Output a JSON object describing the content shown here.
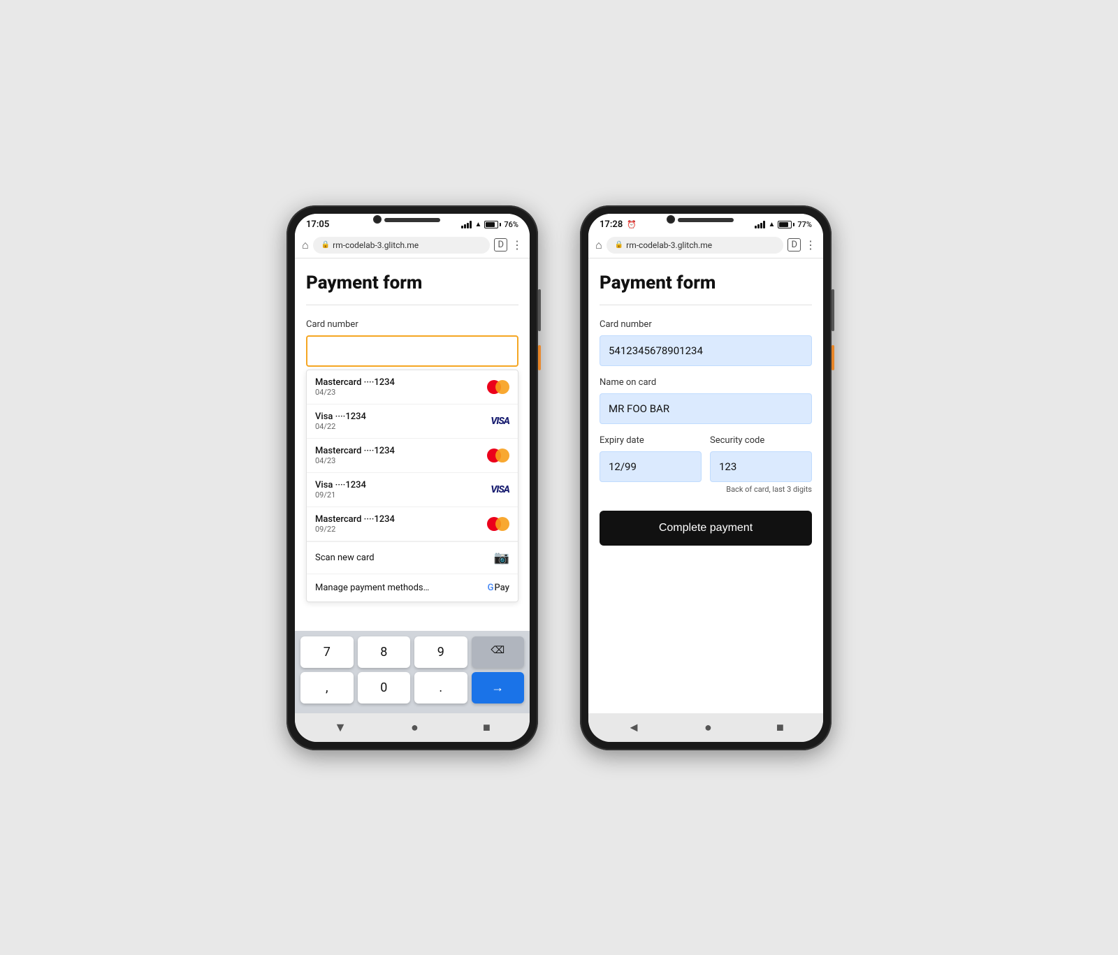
{
  "phones": [
    {
      "id": "left",
      "statusBar": {
        "time": "17:05",
        "batteryPercent": "76%",
        "batteryFill": "76"
      },
      "browserUrl": "rm-codelab-3.glitch.me",
      "pageTitle": "Payment form",
      "cardNumberLabel": "Card number",
      "cardInputPlaceholder": "",
      "savedCards": [
        {
          "brand": "Mastercard",
          "dots": "····1234",
          "expiry": "04/23",
          "type": "mastercard"
        },
        {
          "brand": "Visa",
          "dots": "····1234",
          "expiry": "04/22",
          "type": "visa"
        },
        {
          "brand": "Mastercard",
          "dots": "····1234",
          "expiry": "04/23",
          "type": "mastercard"
        },
        {
          "brand": "Visa",
          "dots": "····1234",
          "expiry": "09/21",
          "type": "visa"
        },
        {
          "brand": "Mastercard",
          "dots": "····1234",
          "expiry": "09/22",
          "type": "mastercard"
        }
      ],
      "scanNewCard": "Scan new card",
      "managePaymentMethods": "Manage payment methods…",
      "keyboard": {
        "rows": [
          [
            "7",
            "8",
            "9"
          ],
          [
            ",",
            "0",
            "."
          ]
        ],
        "deleteKey": "⌫",
        "nextKey": "→"
      }
    },
    {
      "id": "right",
      "statusBar": {
        "time": "17:28",
        "batteryPercent": "77%",
        "batteryFill": "77"
      },
      "browserUrl": "rm-codelab-3.glitch.me",
      "pageTitle": "Payment form",
      "cardNumberLabel": "Card number",
      "cardNumberValue": "5412345678901234",
      "nameOnCardLabel": "Name on card",
      "nameOnCardValue": "MR FOO BAR",
      "expiryDateLabel": "Expiry date",
      "expiryDateValue": "12/99",
      "securityCodeLabel": "Security code",
      "securityCodeValue": "123",
      "securityCodeHint": "Back of card, last 3 digits",
      "completePaymentBtn": "Complete payment"
    }
  ]
}
